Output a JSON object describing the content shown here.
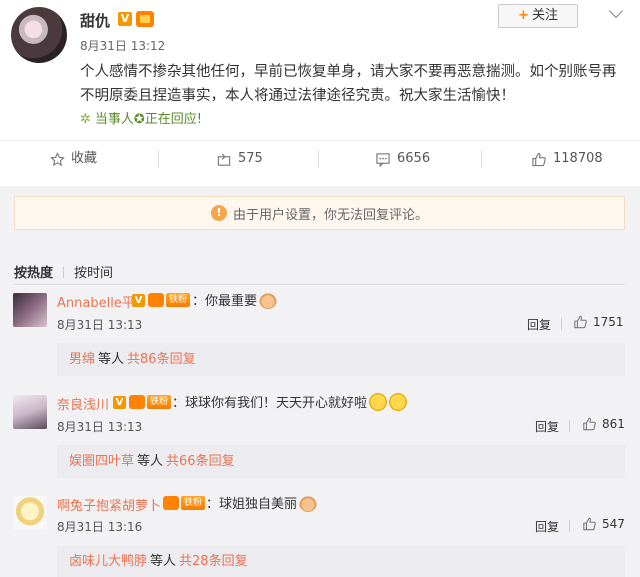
{
  "post": {
    "author": "甜仇",
    "time": "8月31日 13:12",
    "follow_label": "关注",
    "content": "个人感情不掺杂其他任何，早前已恢复单身，请大家不要再恶意揣测。如个别账号再不明原委且捏造事实，本人将通过法律途径究责。祝大家生活愉快！",
    "party_text": "当事人✪正在回应!",
    "icons": {
      "verified": "verified-v-icon",
      "vip": "vip-crown-icon",
      "more": "chevron-down-icon"
    }
  },
  "actions": [
    {
      "label": "收藏",
      "icon": "star-icon"
    },
    {
      "label": "575",
      "icon": "share-icon"
    },
    {
      "label": "6656",
      "icon": "comment-icon"
    },
    {
      "label": "118708",
      "icon": "thumb-up-icon"
    }
  ],
  "notice": {
    "text": "由于用户设置，你无法回复评论。",
    "icon": "warning-icon"
  },
  "sort": {
    "active": "按热度",
    "other": "按时间"
  },
  "comments": [
    {
      "name": "Annabelle平",
      "badge_fan": "铁粉",
      "text": "你最重要",
      "time": "8月31日 13:13",
      "reply_label": "回复",
      "likes": "1751",
      "sub_user": "男绵",
      "sub_etc": "等人",
      "sub_count": "共86条回复"
    },
    {
      "name": "奈良浅川",
      "badge_fan": "铁粉",
      "text": "球球你有我们！天天开心就好啦",
      "time": "8月31日 13:13",
      "reply_label": "回复",
      "likes": "861",
      "sub_user": "娱圈四叶草",
      "sub_etc": "等人",
      "sub_count": "共66条回复"
    },
    {
      "name": "啊兔子抱紧胡萝卜",
      "badge_fan": "铁粉",
      "text": "球姐独自美丽",
      "time": "8月31日 13:16",
      "reply_label": "回复",
      "likes": "547",
      "sub_user": "卤味儿大鸭脖",
      "sub_etc": "等人",
      "sub_count": "共28条回复"
    }
  ],
  "colors": {
    "accent": "#eb7350",
    "orange": "#ff8200",
    "green": "#5b8c2a"
  }
}
